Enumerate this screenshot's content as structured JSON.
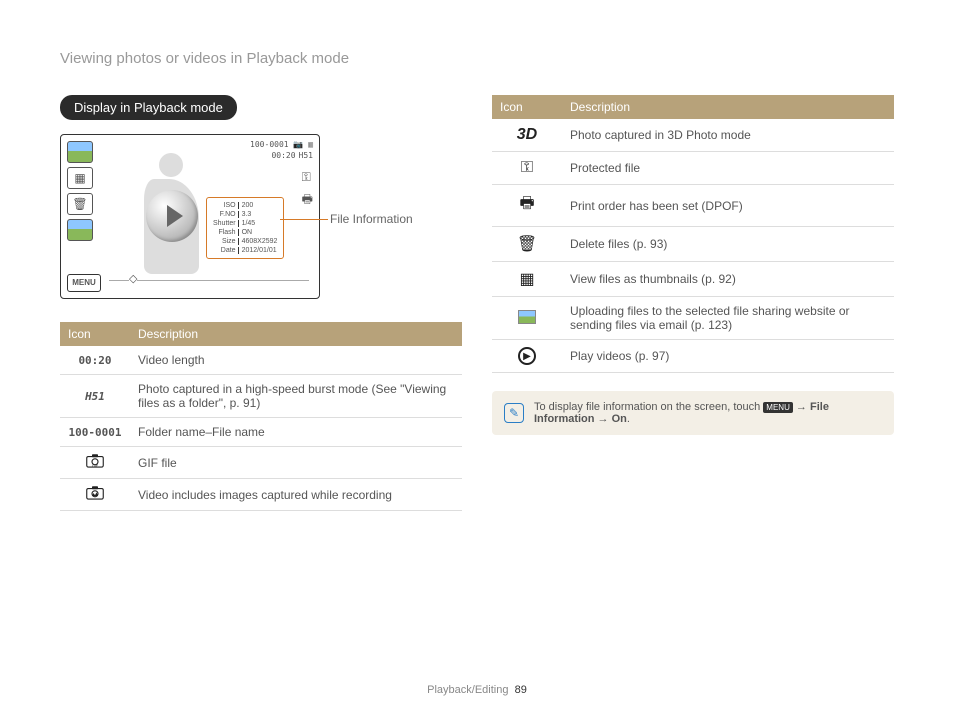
{
  "page_title": "Viewing photos or videos in Playback mode",
  "section_pill": "Display in Playback mode",
  "callout": "File Information",
  "screen_overlay": {
    "folder_file": "100-0001",
    "time": "00:20",
    "burst": "H51",
    "info_labels": [
      "ISO",
      "F.NO",
      "Shutter",
      "Flash",
      "Size",
      "Date"
    ],
    "info_values": [
      "200",
      "3.3",
      "1/45",
      "ON",
      "4608X2592",
      "2012/01/01"
    ],
    "menu": "MENU"
  },
  "table_headers": {
    "icon": "Icon",
    "desc": "Description"
  },
  "left_rows": [
    {
      "icon_text": "00:20",
      "desc": "Video length"
    },
    {
      "icon_text": "H51",
      "desc": "Photo captured in a high-speed burst mode (See \"Viewing files as a folder\", p. 91)"
    },
    {
      "icon_text": "100-0001",
      "desc": "Folder name–File name"
    },
    {
      "icon_svg": "gif",
      "desc": "GIF file"
    },
    {
      "icon_svg": "vidimg",
      "desc": "Video includes images captured while recording"
    }
  ],
  "right_rows": [
    {
      "glyph": "3d",
      "desc": "Photo captured in 3D Photo mode"
    },
    {
      "glyph": "key",
      "desc": "Protected file"
    },
    {
      "glyph": "print",
      "desc": "Print order has been set (DPOF)"
    },
    {
      "glyph": "trash",
      "desc": "Delete files (p. 93)"
    },
    {
      "glyph": "thumbs",
      "desc": "View files as thumbnails (p. 92)"
    },
    {
      "glyph": "upload",
      "desc": "Uploading files to the selected file sharing website or sending files via email (p. 123)"
    },
    {
      "glyph": "play",
      "desc": "Play videos (p. 97)"
    }
  ],
  "note": {
    "prefix": "To display file information on the screen, touch ",
    "menu_chip": "MENU",
    "arrow": " → ",
    "bold1": "File Information",
    "bold2": "On",
    "suffix": "."
  },
  "footer": {
    "section": "Playback/Editing",
    "page": "89"
  }
}
